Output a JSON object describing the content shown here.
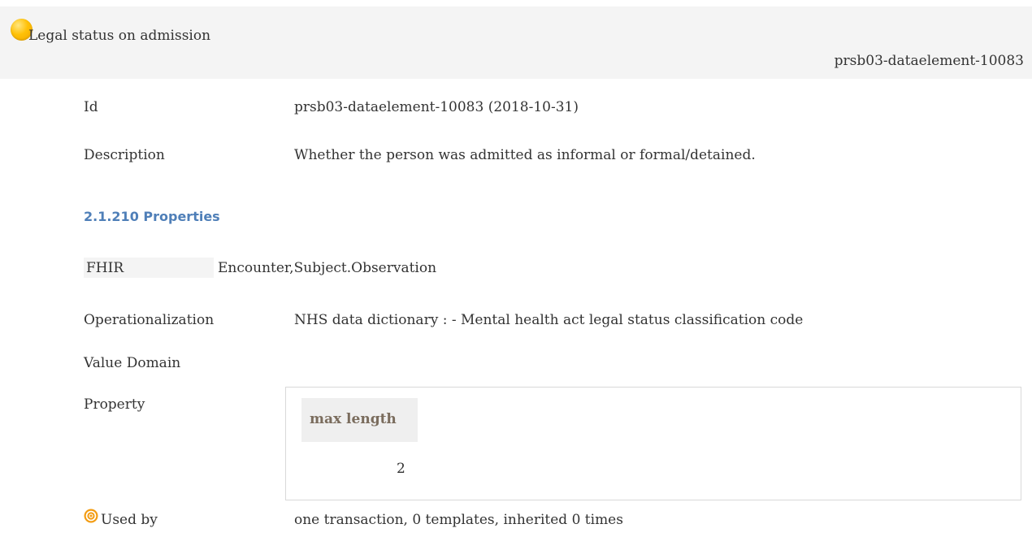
{
  "header": {
    "title": "Legal status on admission",
    "element_id": "prsb03-dataelement-10083",
    "status_icon": "status-circle-icon",
    "status_color": "#ffc107"
  },
  "fields": {
    "id_label": "Id",
    "id_value": "prsb03-dataelement-10083 (2018-10-31)",
    "description_label": "Description",
    "description_value": "Whether the person was admitted as informal or formal/detained."
  },
  "properties": {
    "section_title": "2.1.210 Properties",
    "fhir_label": "FHIR",
    "fhir_value": "Encounter,Subject.Observation",
    "operationalization_label": "Operationalization",
    "operationalization_value": "NHS data dictionary : - Mental health act legal status classification code",
    "value_domain_label": "Value Domain",
    "property_label": "Property",
    "property_table": {
      "header": "max length",
      "value": "2"
    },
    "used_by_icon": "target-icon",
    "used_by_label": "Used by",
    "used_by_value": "one transaction, 0 templates, inherited 0 times"
  }
}
